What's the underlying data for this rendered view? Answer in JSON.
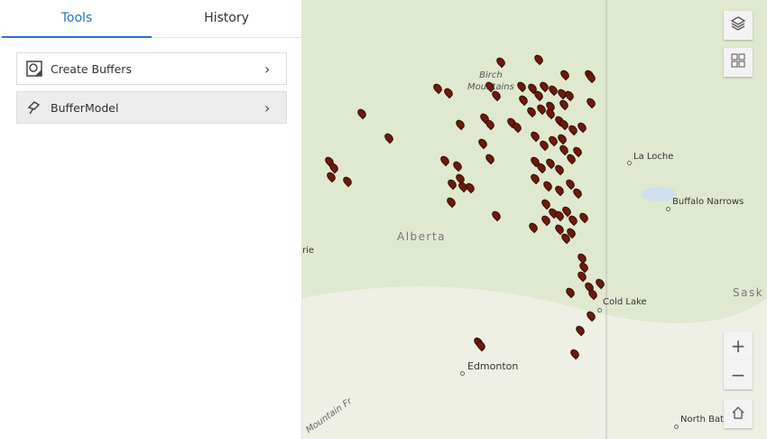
{
  "panel": {
    "tabs": [
      {
        "label": "Tools",
        "active": true
      },
      {
        "label": "History",
        "active": false
      }
    ],
    "items": [
      {
        "label": "Create Buffers",
        "icon": "buffer-map-icon"
      },
      {
        "label": "BufferModel",
        "icon": "hammer-tool-icon"
      }
    ]
  },
  "map": {
    "labels": {
      "birch": "Birch\nMountains",
      "alberta": "Alberta",
      "laloche": "La Loche",
      "buffalo": "Buffalo Narrows",
      "sask": "Sask",
      "coldlake": "Cold Lake",
      "edmonton": "Edmonton",
      "northbattl": "North Battl",
      "rie": "rie",
      "mountain": "Mountain Fr"
    },
    "controls": [
      "layers-icon",
      "basemap-gallery-icon",
      "zoom-in-icon",
      "zoom-out-icon",
      "home-icon"
    ],
    "marker_color": "#6b1a0c"
  }
}
